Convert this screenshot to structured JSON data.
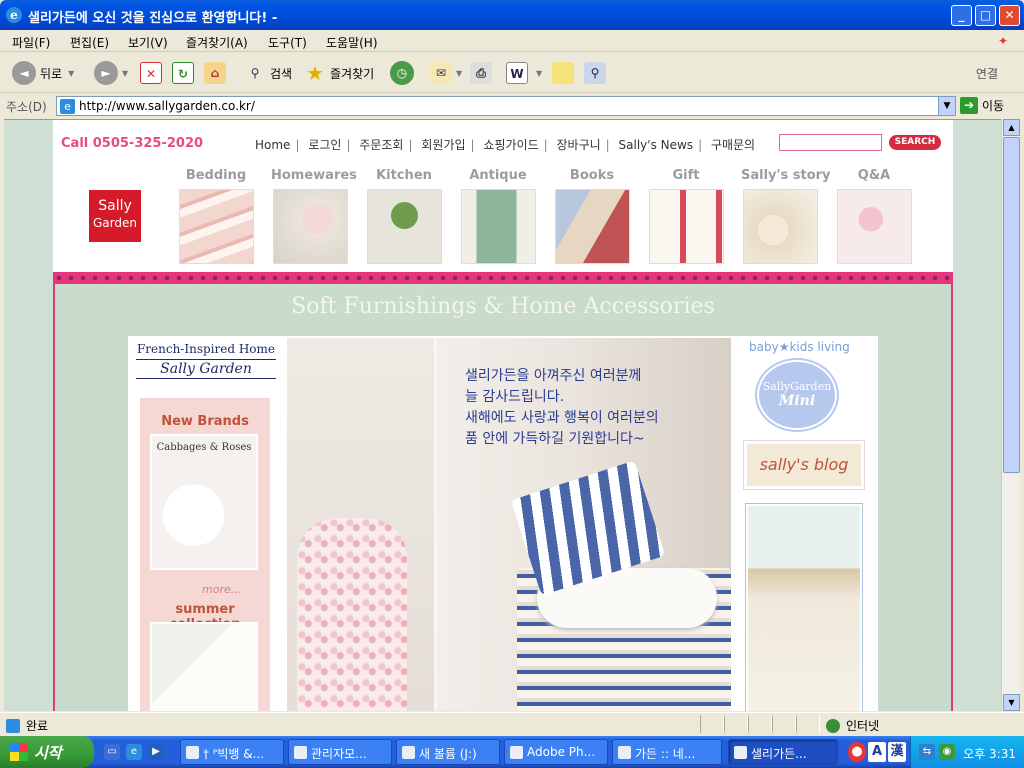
{
  "window": {
    "title": "샐리가든에 오신 것을 진심으로 환영합니다! -"
  },
  "menu": [
    "파일(F)",
    "편집(E)",
    "보기(V)",
    "즐겨찾기(A)",
    "도구(T)",
    "도움말(H)"
  ],
  "toolbar": {
    "back": "뒤로",
    "search": "검색",
    "favorites": "즐겨찾기",
    "links": "연결"
  },
  "address": {
    "label": "주소(D)",
    "url": "http://www.sallygarden.co.kr/",
    "go": "이동"
  },
  "site": {
    "call": "Call 0505-325-2020",
    "nav": [
      "Home",
      "로그인",
      "주문조회",
      "회원가입",
      "쇼핑가이드",
      "장바구니",
      "Sally's News",
      "구매문의"
    ],
    "search_btn": "SEARCH",
    "logo_line1": "Sally",
    "logo_line2": "Garden",
    "categories": [
      "Bedding",
      "Homewares",
      "Kitchen",
      "Antique",
      "Books",
      "Gift",
      "Sally's story",
      "Q&A"
    ],
    "tagline": "Soft Furnishings & Home Accessories",
    "french_1": "French-Inspired Home",
    "french_2": "Sally Garden",
    "new_brands": "New Brands",
    "cabbages": "Cabbages & Roses",
    "more": "more...",
    "summer": "summer collection",
    "message": [
      "샐리가든을 아껴주신 여러분께",
      "늘 감사드립니다.",
      "새해에도 사랑과 행복이 여러분의",
      "품 안에 가득하길 기원합니다~"
    ],
    "baby_kids": "baby★kids living",
    "mini_1": "SallyGarden",
    "mini_2": "Mini",
    "blog": "sally's blog"
  },
  "status": {
    "text": "완료",
    "zone": "인터넷"
  },
  "taskbar": {
    "start": "시작",
    "tasks": [
      "† ᴾ빅뱅 &...",
      "관리자모...",
      "새 볼륨 (J:)",
      "Adobe Ph...",
      "가든 :: 네...",
      "샐리가든..."
    ],
    "ime_a": "A",
    "ime_han": "漢",
    "clock": "오후 3:31"
  },
  "colors": {
    "accent_pink": "#e5357f",
    "bg_green": "#c9dccb",
    "logo_red": "#d51a2a"
  }
}
